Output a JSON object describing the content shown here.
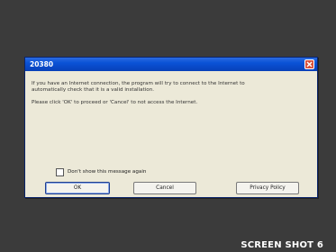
{
  "dialog": {
    "title": "20380",
    "message_line1": "If you have an Internet connection, the program will try to connect to the Internet to",
    "message_line2": "automatically check that it is a valid installation.",
    "message_line3": "Please click 'OK' to proceed or 'Cancel' to not access the Internet.",
    "checkbox_label": "Don't show this message again",
    "checkbox_checked": false,
    "buttons": {
      "ok": "OK",
      "cancel": "Cancel",
      "privacy": "Privacy Policy"
    },
    "close_icon": "close-icon",
    "colors": {
      "titlebar": "#0a52d6",
      "close_button": "#d8503b",
      "dialog_bg": "#ece9d8"
    }
  },
  "caption": {
    "text": "SCREEN SHOT 6"
  }
}
